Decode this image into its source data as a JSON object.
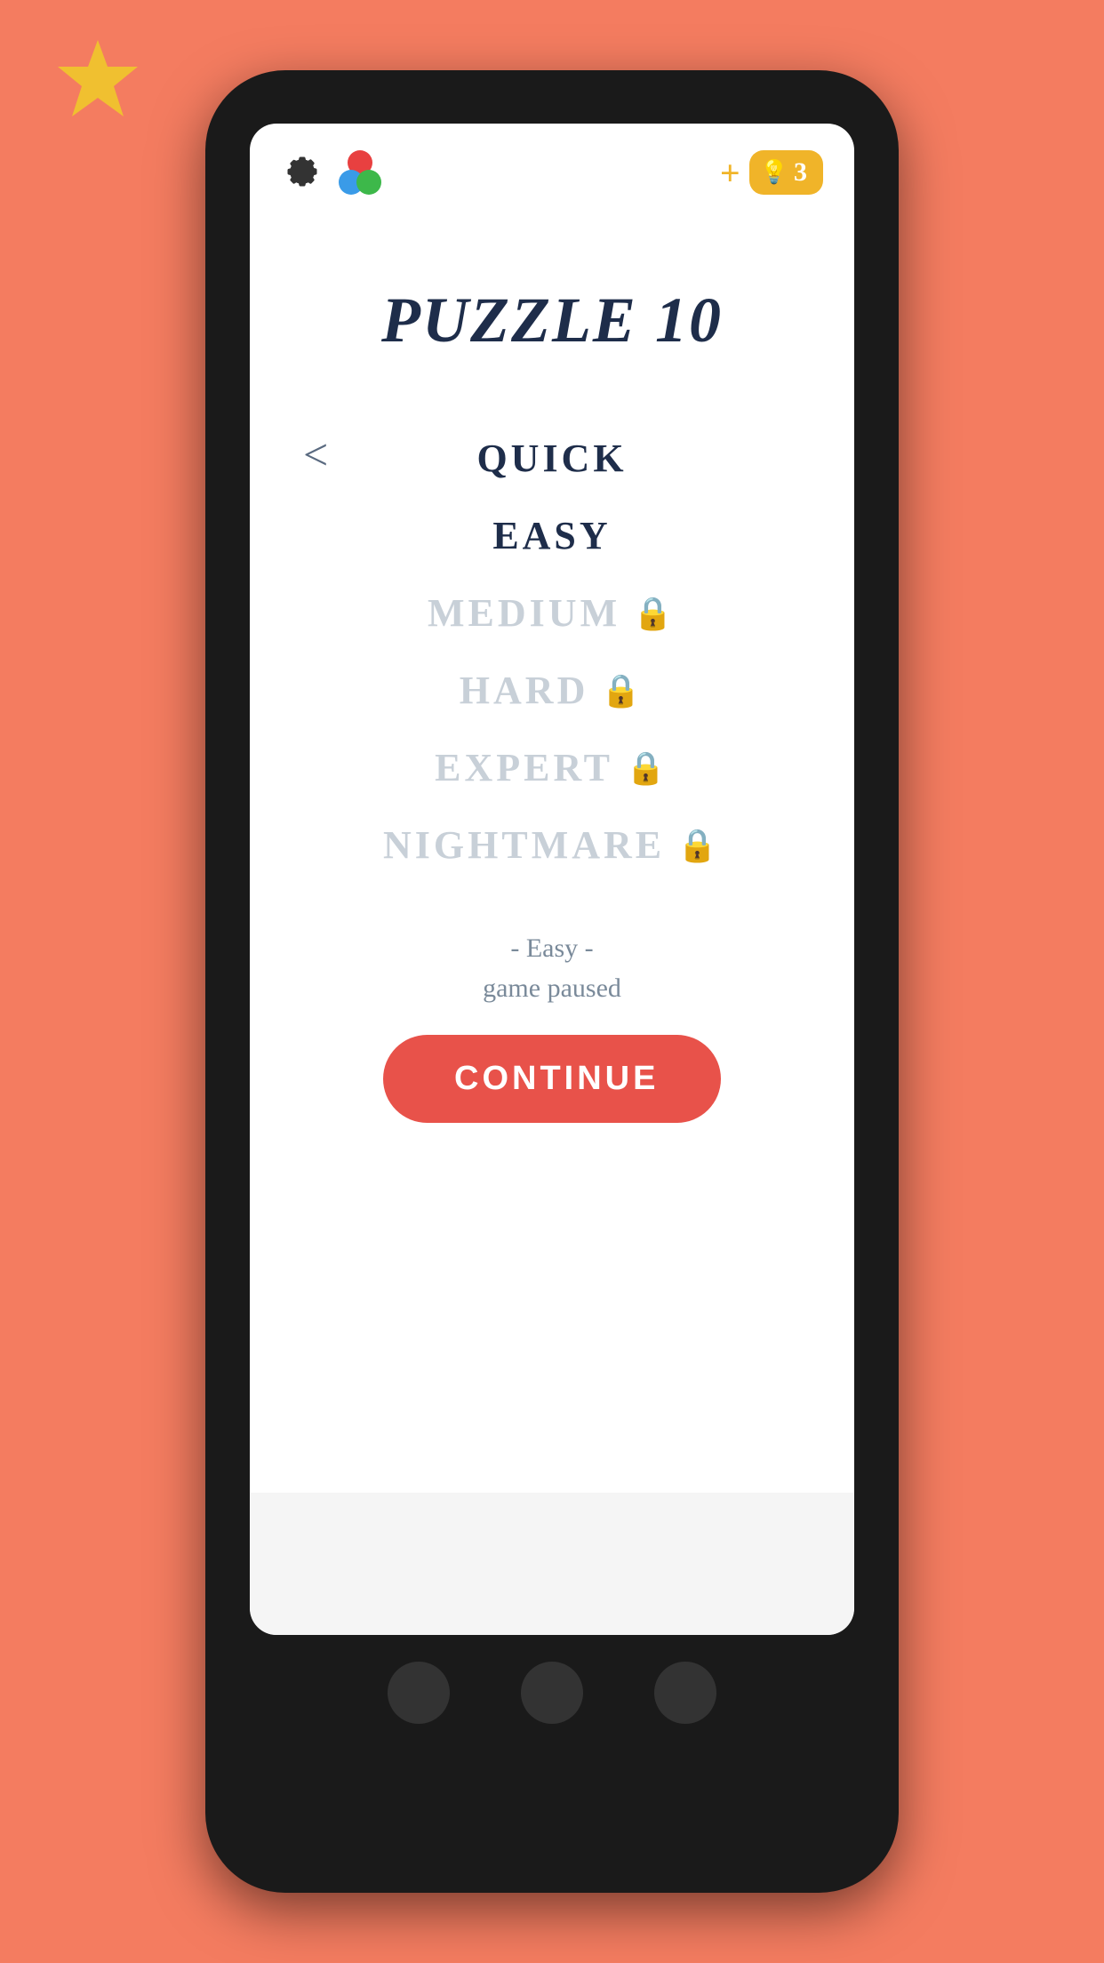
{
  "background": {
    "color": "#F47C60"
  },
  "star": {
    "color": "#F0C030",
    "position": "top-left"
  },
  "header": {
    "settings_icon": "gear",
    "game_center_icon": "game-center-circles",
    "plus_label": "+",
    "hint_icon": "lightbulb",
    "hint_count": "3"
  },
  "puzzle": {
    "title": "PUZZLE 10"
  },
  "difficulty": {
    "back_arrow": "<",
    "items": [
      {
        "label": "QUICK",
        "locked": false
      },
      {
        "label": "EASY",
        "locked": false
      },
      {
        "label": "MEDIUM",
        "locked": true
      },
      {
        "label": "HARD",
        "locked": true
      },
      {
        "label": "EXPERT",
        "locked": true
      },
      {
        "label": "NIGHTMARE",
        "locked": true
      }
    ]
  },
  "status": {
    "line1": "- Easy -",
    "line2": "game paused"
  },
  "continue_button": {
    "label": "CONTINUE"
  }
}
